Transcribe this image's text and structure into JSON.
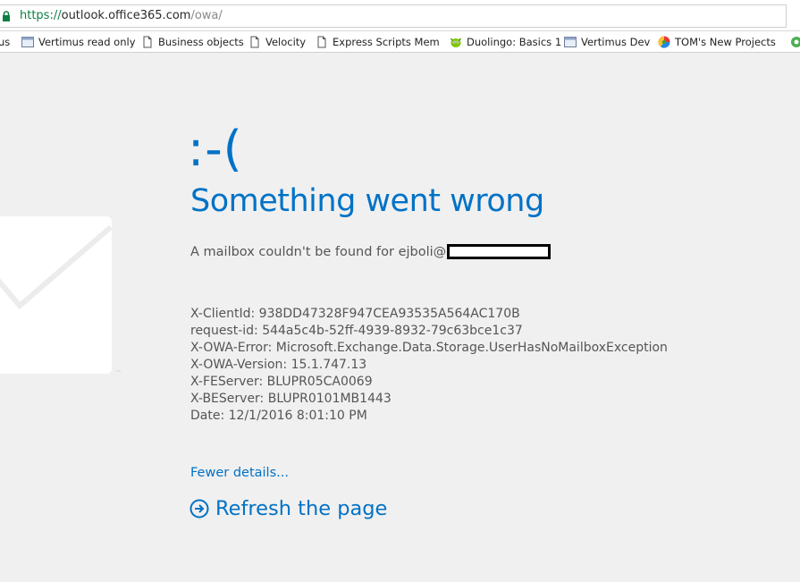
{
  "browser": {
    "url": {
      "scheme": "https://",
      "host": "outlook.office365.com",
      "path": "/owa/"
    },
    "bookmarks": [
      {
        "label": "us",
        "icon": "none"
      },
      {
        "label": "Vertimus read only",
        "icon": "window-icon"
      },
      {
        "label": "Business objects",
        "icon": "page-icon"
      },
      {
        "label": "Velocity",
        "icon": "page-icon"
      },
      {
        "label": "Express Scripts Memb",
        "icon": "page-icon"
      },
      {
        "label": "Duolingo: Basics 1",
        "icon": "duolingo-icon"
      },
      {
        "label": "Vertimus Dev",
        "icon": "window-icon"
      },
      {
        "label": "TOM's New Projects, F",
        "icon": "chart-icon"
      }
    ]
  },
  "error": {
    "face": ":-(",
    "title": "Something went wrong",
    "message": "A mailbox couldn't be found for ejboli@",
    "details": [
      "X-ClientId: 938DD47328F947CEA93535A564AC170B",
      "request-id: 544a5c4b-52ff-4939-8932-79c63bce1c37",
      "X-OWA-Error: Microsoft.Exchange.Data.Storage.UserHasNoMailboxException",
      "X-OWA-Version: 15.1.747.13",
      "X-FEServer: BLUPR05CA0069",
      "X-BEServer: BLUPR0101MB1443",
      "Date: 12/1/2016 8:01:10 PM"
    ],
    "fewer_details_link": "Fewer details...",
    "refresh_label": "Refresh the page"
  },
  "logo": {
    "trademark": "™"
  },
  "colors": {
    "accent": "#0072c6",
    "background": "#f0f0f0",
    "secure_green": "#0b8043"
  }
}
